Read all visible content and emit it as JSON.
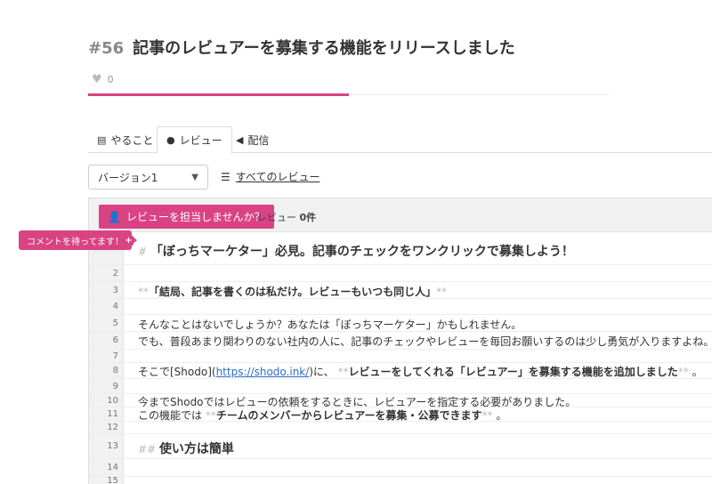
{
  "post": {
    "number": "#56",
    "title": "記事のレビュアーを募集する機能をリリースしました",
    "like_count": "0",
    "progress_fraction": 0.5
  },
  "tabs": [
    {
      "label": "やること",
      "icon": "file-icon"
    },
    {
      "label": "レビュー",
      "icon": "comments-icon",
      "active": true
    },
    {
      "label": "配信",
      "icon": "megaphone-icon"
    }
  ],
  "version_select": {
    "value": "バージョン1"
  },
  "all_reviews_label": "すべてのレビュー",
  "toolbar": {
    "volunteer_label": "レビューを担当しませんか？",
    "review_label": "レビュー",
    "review_count": "0件"
  },
  "tooltip": "コメントを待ってます！",
  "lines": [
    {
      "n": "",
      "md": "# ",
      "text": "「ぼっちマーケター」必見。記事のチェックをワンクリックで募集しよう！"
    },
    {
      "n": "2"
    },
    {
      "n": "3",
      "md": "**",
      "text": "「結局、記事を書くのは私だけ。レビューもいつも同じ人」",
      "md_end": "**"
    },
    {
      "n": "4"
    },
    {
      "n": "5",
      "text": "そんなことはないでしょうか？あなたは「ぼっちマーケター」かもしれません。"
    },
    {
      "n": "6",
      "text": "でも、普段あまり関わりのない社内の人に、記事のチェックやレビューを毎回お願いするのは少し勇気が入りますよね。"
    },
    {
      "n": "7"
    },
    {
      "n": "8",
      "text_pre": "そこで[Shodo](",
      "link": "https://shodo.ink/",
      "text_mid": ")に、 ",
      "md": "**",
      "text": "レビューをしてくれる「レビュアー」を募集する機能を追加しました",
      "md_end": "**",
      "text_post": " 。"
    },
    {
      "n": "9"
    },
    {
      "n": "10",
      "text": "今までShodoではレビューの依頼をするときに、レビュアーを指定する必要がありました。"
    },
    {
      "n": "11",
      "text_pre": "この機能では ",
      "md": "**",
      "text": "チームのメンバーからレビュアーを募集・公募できます",
      "md_end": "**",
      "text_post": " 。"
    },
    {
      "n": "12"
    },
    {
      "n": "13",
      "md": "## ",
      "text": "使い方は簡単"
    },
    {
      "n": "14"
    },
    {
      "n": "15"
    }
  ]
}
